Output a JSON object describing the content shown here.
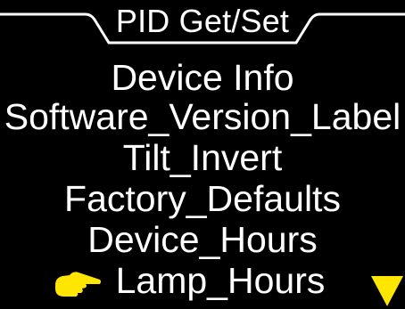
{
  "header": {
    "title": "PID Get/Set"
  },
  "menu": {
    "items": [
      {
        "label": "Device Info"
      },
      {
        "label": "Software_Version_Label"
      },
      {
        "label": "Tilt_Invert"
      },
      {
        "label": "Factory_Defaults"
      },
      {
        "label": "Device_Hours"
      },
      {
        "label": "Lamp_Hours",
        "selected": true
      }
    ]
  },
  "icons": {
    "pointer": "pointing-hand-icon",
    "more": "down-arrow-icon"
  },
  "colors": {
    "background": "#000000",
    "text": "#ffffff",
    "accent": "#ffe600"
  }
}
